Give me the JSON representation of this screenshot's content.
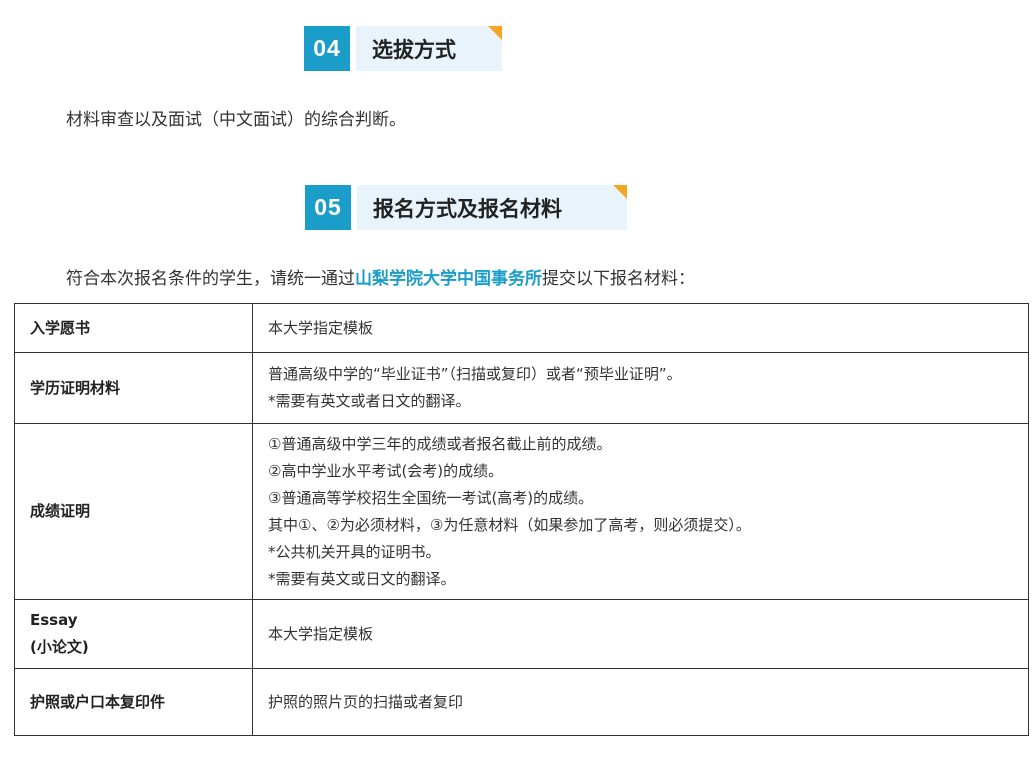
{
  "section_04": {
    "number": "04",
    "title": "选拔方式",
    "text": "材料审查以及面试（中文面试）的综合判断。"
  },
  "section_05": {
    "number": "05",
    "title": "报名方式及报名材料",
    "text_before": "符合本次报名条件的学生，请统一通过",
    "text_highlight": "山梨学院大学中国事务所",
    "text_after": "提交以下报名材料："
  },
  "colors": {
    "accent": "#1a9ec9",
    "title_bg": "#e9f3fb",
    "corner": "#f5a623"
  },
  "table": {
    "rows": [
      {
        "label": "入学愿书",
        "lines": [
          "本大学指定模板"
        ]
      },
      {
        "label": "学历证明材料",
        "lines": [
          "普通高级中学的“毕业证书”（扫描或复印）或者“预毕业证明”。",
          "*需要有英文或者日文的翻译。"
        ]
      },
      {
        "label": "成绩证明",
        "lines": [
          "①普通高级中学三年的成绩或者报名截止前的成绩。",
          "②高中学业水平考试(会考)的成绩。",
          "③普通高等学校招生全国统一考试(高考)的成绩。",
          "其中①、②为必须材料，③为任意材料（如果参加了高考，则必须提交）。",
          "*公共机关开具的证明书。",
          "*需要有英文或日文的翻译。"
        ]
      },
      {
        "label_line1": "Essay",
        "label_line2": "(小论文)",
        "lines": [
          "本大学指定模板"
        ]
      },
      {
        "label": "护照或户口本复印件",
        "lines": [
          "护照的照片页的扫描或者复印"
        ]
      }
    ]
  }
}
